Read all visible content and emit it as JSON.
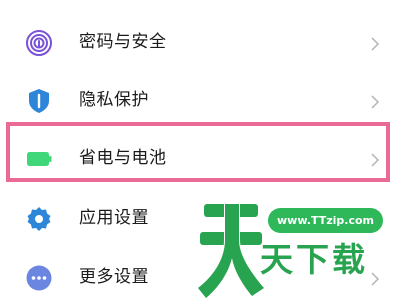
{
  "settings": {
    "items": [
      {
        "label": "密码与安全",
        "icon": "fingerprint-icon",
        "icon_color": "#7a52d8"
      },
      {
        "label": "隐私保护",
        "icon": "shield-icon",
        "icon_color": "#2e86d8"
      },
      {
        "label": "省电与电池",
        "icon": "battery-icon",
        "icon_color": "#3fd77a"
      },
      {
        "label": "应用设置",
        "icon": "gear-icon",
        "icon_color": "#2e86d8"
      },
      {
        "label": "更多设置",
        "icon": "more-dots-icon",
        "icon_color": "#6b86e0"
      }
    ],
    "highlight_color": "#e96a95"
  },
  "watermark": {
    "url": "www.TTzip.com",
    "text": "天下载",
    "color": "#28a350"
  }
}
